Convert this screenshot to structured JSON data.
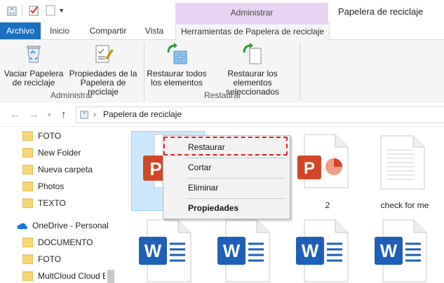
{
  "window": {
    "title": "Papelera de reciclaje",
    "context_tab_header": "Administrar"
  },
  "tabs": [
    {
      "label": "Archivo"
    },
    {
      "label": "Inicio"
    },
    {
      "label": "Compartir"
    },
    {
      "label": "Vista"
    },
    {
      "label": "Herramientas de Papelera de reciclaje"
    }
  ],
  "ribbon": {
    "groups": [
      {
        "label": "Administrar",
        "buttons": [
          {
            "line1": "Vaciar Papelera",
            "line2": "de reciclaje",
            "icon": "recycle-bin-icon"
          },
          {
            "line1": "Propiedades de la",
            "line2": "Papelera de reciclaje",
            "icon": "properties-icon"
          }
        ]
      },
      {
        "label": "Restaurar",
        "buttons": [
          {
            "line1": "Restaurar todos",
            "line2": "los elementos",
            "icon": "restore-all-icon"
          },
          {
            "line1": "Restaurar los elementos",
            "line2": "seleccionados",
            "icon": "restore-selected-icon"
          }
        ]
      }
    ]
  },
  "address": {
    "path": "Papelera de reciclaje",
    "separator": "›"
  },
  "sidebar": {
    "items": [
      {
        "label": "FOTO"
      },
      {
        "label": "New Folder"
      },
      {
        "label": "Nueva carpeta"
      },
      {
        "label": "Photos"
      },
      {
        "label": "TEXTO"
      },
      {
        "label": "OneDrive - Personal"
      },
      {
        "label": "DOCUMENTO"
      },
      {
        "label": "FOTO"
      },
      {
        "label": "MultCloud Cloud E"
      }
    ]
  },
  "files": [
    {
      "label": "",
      "type": "powerpoint"
    },
    {
      "label": "",
      "type": "powerpoint"
    },
    {
      "label": "2",
      "type": "powerpoint"
    },
    {
      "label": "check for me",
      "type": "text"
    },
    {
      "label": "",
      "type": "word"
    },
    {
      "label": "",
      "type": "word"
    },
    {
      "label": "",
      "type": "word"
    },
    {
      "label": "",
      "type": "word"
    }
  ],
  "context_menu": {
    "items": [
      {
        "label": "Restaurar",
        "highlighted": true
      },
      {
        "label": "Cortar"
      },
      {
        "label": "Eliminar"
      },
      {
        "label": "Propiedades",
        "bold": true
      }
    ]
  },
  "colors": {
    "accent": "#1a6fc0",
    "context_tab": "#e8d4f2",
    "selection": "#cce8ff",
    "highlight": "#e0202a",
    "powerpoint": "#d24726",
    "word": "#1e5fb8"
  }
}
